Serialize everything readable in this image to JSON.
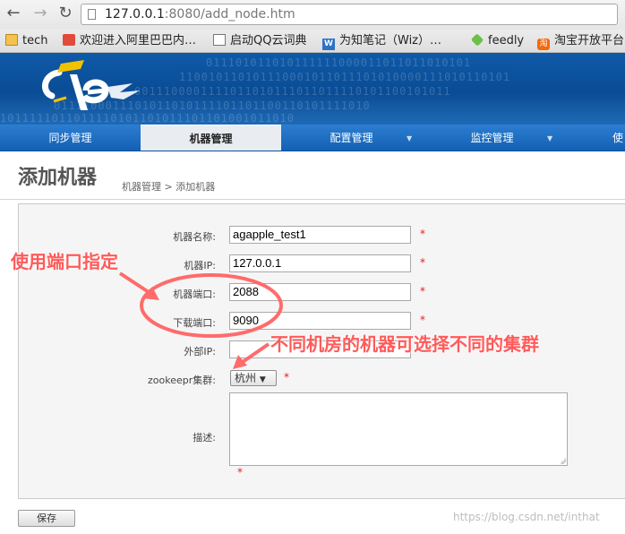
{
  "browser": {
    "url_host": "127.0.0.1",
    "url_rest": ":8080/add_node.htm",
    "bookmarks": [
      {
        "label": "tech",
        "icon": "folder-icon"
      },
      {
        "label": "欢迎进入阿里巴巴内…",
        "icon": "aliyun-icon"
      },
      {
        "label": "启动QQ云词典",
        "icon": "page-icon"
      },
      {
        "label": "为知笔记（Wiz）…",
        "icon": "wiz-icon"
      },
      {
        "label": "feedly",
        "icon": "feedly-icon"
      },
      {
        "label": "淘宝开放平台",
        "icon": "taobao-icon"
      }
    ]
  },
  "menu": {
    "items": [
      "同步管理",
      "机器管理",
      "配置管理",
      "监控管理",
      "使"
    ],
    "active_index": 1
  },
  "page": {
    "title": "添加机器",
    "breadcrumb": "机器管理 > 添加机器"
  },
  "form": {
    "name_label": "机器名称:",
    "name_value": "agapple_test1",
    "ip_label": "机器IP:",
    "ip_value": "127.0.0.1",
    "port_label": "机器端口:",
    "port_value": "2088",
    "download_port_label": "下载端口:",
    "download_port_value": "9090",
    "external_ip_label": "外部IP:",
    "external_ip_value": "",
    "cluster_label": "zookeepr集群:",
    "cluster_value": "杭州",
    "description_label": "描述:",
    "required_mark": "*",
    "save_label": "保存"
  },
  "annotations": {
    "port_note": "使用端口指定",
    "cluster_note": "不同机房的机器可选择不同的集群"
  },
  "watermark": "https://blog.csdn.net/inthat",
  "colors": {
    "menu_blue": "#1a6cc2",
    "annotation_red": "#ff5a5a",
    "required_red": "#dd2222"
  }
}
